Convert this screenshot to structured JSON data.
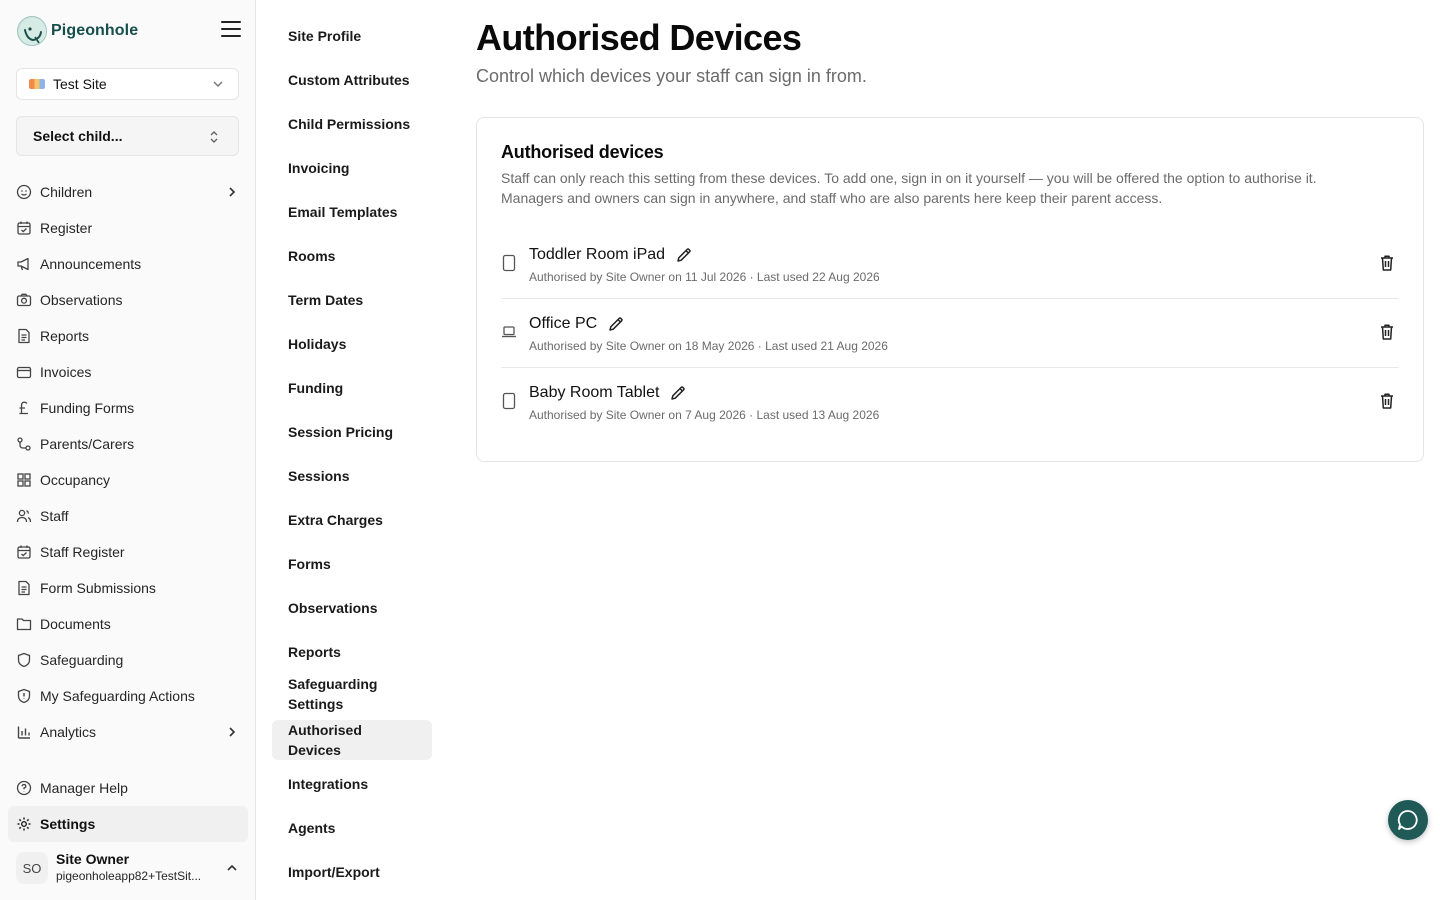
{
  "brand": {
    "name": "Pigeonhole"
  },
  "site_select": {
    "value": "Test Site"
  },
  "child_select": {
    "value": "Select child..."
  },
  "nav": {
    "items": [
      {
        "label": "Children",
        "icon": "child-face-icon",
        "has_arrow": true
      },
      {
        "label": "Register",
        "icon": "calendar-check-icon"
      },
      {
        "label": "Announcements",
        "icon": "megaphone-icon"
      },
      {
        "label": "Observations",
        "icon": "camera-icon"
      },
      {
        "label": "Reports",
        "icon": "file-text-icon"
      },
      {
        "label": "Invoices",
        "icon": "wallet-icon"
      },
      {
        "label": "Funding Forms",
        "icon": "pound-icon"
      },
      {
        "label": "Parents/Carers",
        "icon": "link-icon"
      },
      {
        "label": "Occupancy",
        "icon": "grid-icon"
      },
      {
        "label": "Staff",
        "icon": "users-icon"
      },
      {
        "label": "Staff Register",
        "icon": "calendar-check-icon"
      },
      {
        "label": "Form Submissions",
        "icon": "file-text-icon"
      },
      {
        "label": "Documents",
        "icon": "folder-icon"
      },
      {
        "label": "Safeguarding",
        "icon": "shield-icon"
      },
      {
        "label": "My Safeguarding Actions",
        "icon": "shield-alert-icon"
      },
      {
        "label": "Analytics",
        "icon": "bar-chart-icon",
        "has_arrow": true
      }
    ],
    "bottom": [
      {
        "label": "Manager Help",
        "icon": "help-circle-icon"
      },
      {
        "label": "Settings",
        "icon": "gear-icon",
        "active": true
      }
    ]
  },
  "user": {
    "initials": "SO",
    "name": "Site Owner",
    "email": "pigeonholeapp82+TestSit..."
  },
  "subnav": {
    "items": [
      "Site Profile",
      "Custom Attributes",
      "Child Permissions",
      "Invoicing",
      "Email Templates",
      "Rooms",
      "Term Dates",
      "Holidays",
      "Funding",
      "Session Pricing",
      "Sessions",
      "Extra Charges",
      "Forms",
      "Observations",
      "Reports",
      "Safeguarding Settings",
      "Authorised Devices",
      "Integrations",
      "Agents",
      "Import/Export"
    ],
    "active": "Authorised Devices"
  },
  "page": {
    "title": "Authorised Devices",
    "subtitle": "Control which devices your staff can sign in from."
  },
  "card": {
    "title": "Authorised devices",
    "description": "Staff can only reach this setting from these devices. To add one, sign in on it yourself — you will be offered the option to authorise it. Managers and owners can sign in anywhere, and staff who are also parents here keep their parent access."
  },
  "devices": [
    {
      "name": "Toddler Room iPad",
      "type": "tablet",
      "icon": "tablet-icon",
      "meta": "Authorised by Site Owner on 11 Jul 2026 · Last used 22 Aug 2026"
    },
    {
      "name": "Office PC",
      "type": "laptop",
      "icon": "laptop-icon",
      "meta": "Authorised by Site Owner on 18 May 2026 · Last used 21 Aug 2026"
    },
    {
      "name": "Baby Room Tablet",
      "type": "tablet",
      "icon": "tablet-icon",
      "meta": "Authorised by Site Owner on 7 Aug 2026 · Last used 13 Aug 2026"
    }
  ],
  "colors": {
    "brand": "#164e4b",
    "chat_fab": "#1f5a57",
    "muted_text": "#6b6b6b",
    "active_bg": "#f0f0f0"
  }
}
